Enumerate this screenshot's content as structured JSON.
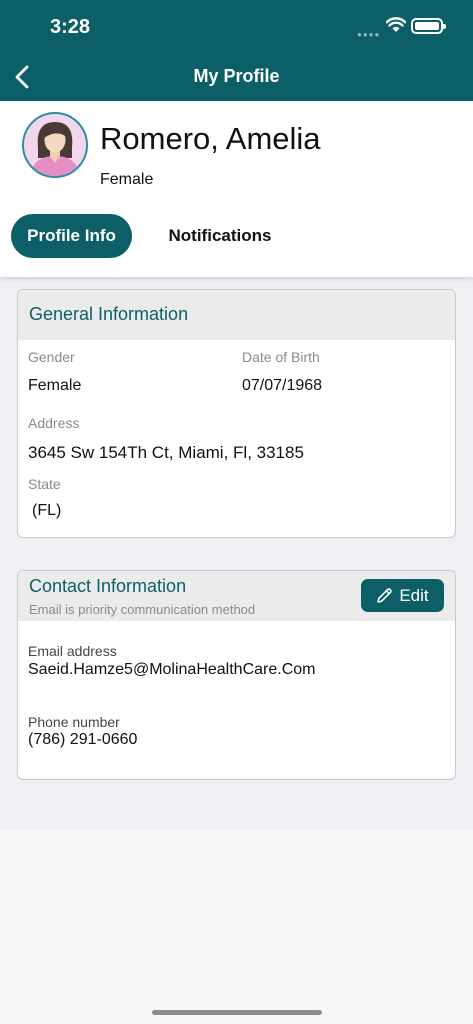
{
  "status_bar": {
    "time": "3:28"
  },
  "nav": {
    "title": "My Profile"
  },
  "profile": {
    "name": "Romero, Amelia",
    "gender": "Female"
  },
  "tabs": [
    {
      "label": "Profile Info",
      "active": true
    },
    {
      "label": "Notifications",
      "active": false
    }
  ],
  "general": {
    "title": "General Information",
    "gender_label": "Gender",
    "gender_value": "Female",
    "dob_label": "Date of Birth",
    "dob_value": "07/07/1968",
    "address_label": "Address",
    "address_value": "3645 Sw 154Th Ct, Miami, Fl, 33185",
    "state_label": "State",
    "state_value": "(FL)"
  },
  "contact": {
    "title": "Contact Information",
    "subtitle": "Email is priority communication method",
    "edit_label": "Edit",
    "email_label": "Email address",
    "email_value": "Saeid.Hamze5@MolinaHealthCare.Com",
    "phone_label": "Phone number",
    "phone_value": "(786) 291-0660"
  },
  "colors": {
    "brand": "#0c5f66",
    "title_text": "#0c5f66",
    "card_header": "#ebebeb"
  },
  "icons": [
    "back-chevron-icon",
    "wifi-icon",
    "battery-icon",
    "signal-dots-icon",
    "avatar-female-icon",
    "pencil-icon"
  ]
}
